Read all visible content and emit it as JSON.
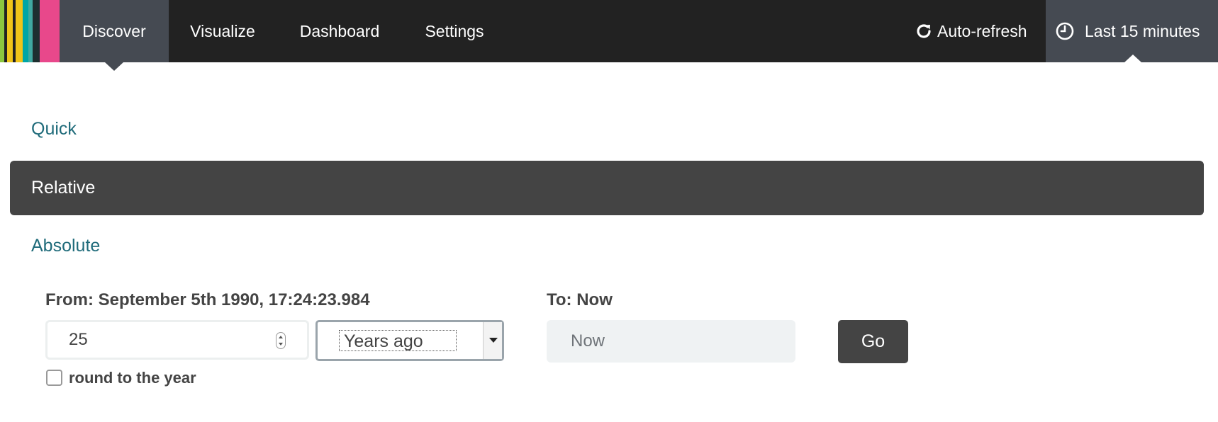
{
  "nav": {
    "brand_colors": [
      "#8cc63f",
      "#f0c419",
      "#00a6a6",
      "#28333d",
      "#e8488b"
    ],
    "items": [
      {
        "label": "Discover"
      },
      {
        "label": "Visualize"
      },
      {
        "label": "Dashboard"
      },
      {
        "label": "Settings"
      }
    ],
    "active_item": "Discover",
    "auto_refresh": {
      "label": "Auto-refresh",
      "icon": "refresh-icon"
    },
    "time_picker": {
      "label": "Last 15 minutes",
      "icon": "clock-icon"
    }
  },
  "modes": {
    "quick": "Quick",
    "relative": "Relative",
    "absolute": "Absolute",
    "active": "Relative"
  },
  "from": {
    "label": "From: September 5th 1990, 17:24:23.984",
    "count": "25",
    "unit": "Years ago",
    "round_label": "round to the year",
    "round_checked": false
  },
  "to": {
    "label": "To: Now",
    "value": "Now"
  },
  "go_label": "Go"
}
